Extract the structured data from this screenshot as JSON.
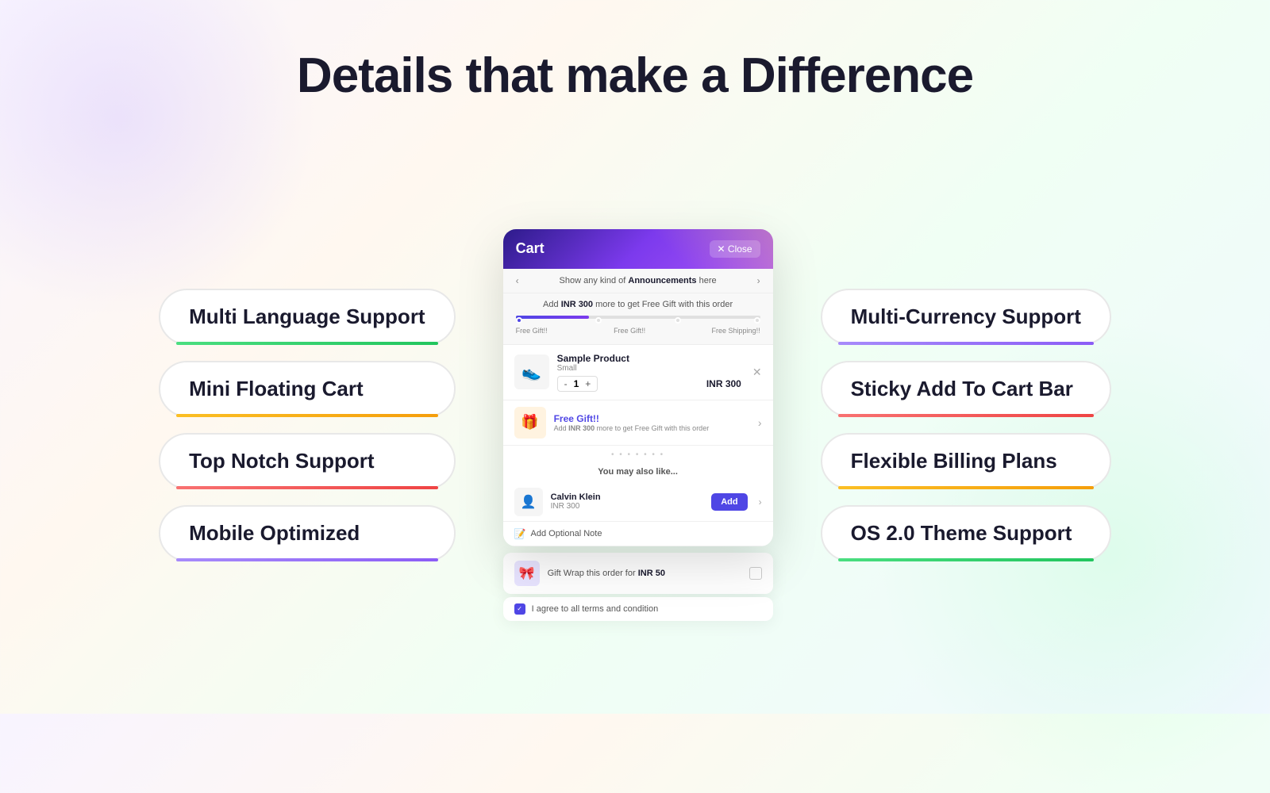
{
  "page": {
    "title": "Details that make a Difference"
  },
  "left_features": [
    {
      "id": "multi-language",
      "label": "Multi Language Support",
      "accent": "green"
    },
    {
      "id": "mini-cart",
      "label": "Mini Floating Cart",
      "accent": "yellow"
    },
    {
      "id": "top-notch",
      "label": "Top Notch Support",
      "accent": "red"
    },
    {
      "id": "mobile-optimized",
      "label": "Mobile Optimized",
      "accent": "purple"
    }
  ],
  "right_features": [
    {
      "id": "multi-currency",
      "label": "Multi-Currency Support",
      "accent": "purple"
    },
    {
      "id": "sticky-cart",
      "label": "Sticky Add To Cart Bar",
      "accent": "red"
    },
    {
      "id": "billing-plans",
      "label": "Flexible Billing Plans",
      "accent": "yellow"
    },
    {
      "id": "os-theme",
      "label": "OS 2.0 Theme Support",
      "accent": "green"
    }
  ],
  "cart": {
    "title": "Cart",
    "close_label": "✕ Close",
    "announcement": "Show any kind of Announcements here",
    "progress_text_prefix": "Add",
    "progress_amount": "INR 300",
    "progress_text_suffix": "more to get Free Gift with this order",
    "progress_labels": [
      "Free Gift!!",
      "Free Gift!!",
      "Free Shipping!!"
    ],
    "item": {
      "name": "Sample Product",
      "variant": "Small",
      "qty": "1",
      "price": "INR 300"
    },
    "free_gift": {
      "title": "Free Gift!!",
      "desc_prefix": "Add",
      "desc_amount": "INR 300",
      "desc_suffix": "more to get Free Gift with this order"
    },
    "recommendation_label": "You may also like...",
    "recommended_item": {
      "name": "Calvin Klein",
      "price": "INR 300",
      "add_label": "Add"
    },
    "add_note_label": "Add Optional Note"
  },
  "gift_wrap": {
    "text_prefix": "Gift Wrap this order for",
    "amount": "INR 50"
  },
  "terms": {
    "label": "I agree to all terms and condition"
  }
}
